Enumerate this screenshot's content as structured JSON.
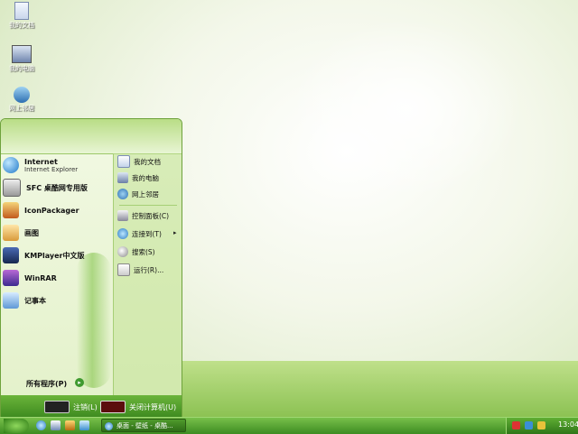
{
  "desktop": {
    "icons": [
      {
        "label": "我的文档",
        "icon": "documents-icon"
      },
      {
        "label": "我的电脑",
        "icon": "computer-icon"
      },
      {
        "label": "网上邻居",
        "icon": "network-places-icon"
      }
    ]
  },
  "start_menu": {
    "programs": [
      {
        "title": "Internet",
        "subtitle": "Internet Explorer",
        "icon": "internet-explorer-icon"
      },
      {
        "title": "SFC 桌酷网专用版",
        "icon": "sfc-icon"
      },
      {
        "title": "IconPackager",
        "icon": "iconpackager-icon"
      },
      {
        "title": "画图",
        "icon": "paint-icon"
      },
      {
        "title": "KMPlayer中文版",
        "icon": "kmplayer-icon"
      },
      {
        "title": "WinRAR",
        "icon": "winrar-icon"
      },
      {
        "title": "记事本",
        "icon": "notepad-icon"
      }
    ],
    "all_programs": "所有程序(P)",
    "places": [
      {
        "label": "我的文档",
        "icon": "documents-icon"
      },
      {
        "label": "我的电脑",
        "icon": "computer-icon"
      },
      {
        "label": "网上邻居",
        "icon": "network-places-icon"
      },
      {
        "label": "控制面板(C)",
        "icon": "control-panel-icon"
      },
      {
        "label": "连接到(T)",
        "icon": "connect-to-icon",
        "arrow": "▸"
      },
      {
        "label": "搜索(S)",
        "icon": "search-icon"
      },
      {
        "label": "运行(R)...",
        "icon": "run-icon"
      }
    ],
    "logoff": "注销(L)",
    "shutdown": "关闭计算机(U)"
  },
  "taskbar": {
    "task_label": "桌面 - 壁纸 - 桌酷...",
    "clock": "13:04"
  },
  "colors": {
    "accent": "#3d8c22",
    "menu_bg": "#e3f1c9"
  }
}
